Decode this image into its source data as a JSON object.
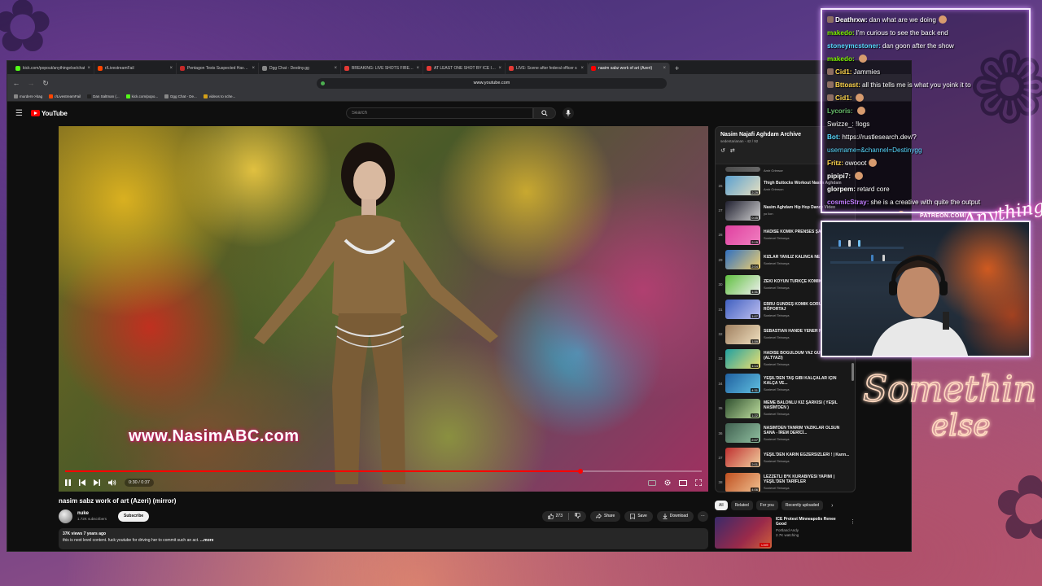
{
  "browser": {
    "tabs": [
      {
        "title": "kick.com/popout/anythingelse/chat",
        "color": "#53fc18"
      },
      {
        "title": "r/LivestreamFail",
        "color": "#ff4500"
      },
      {
        "title": "Pentagon Tests Suspected Havana",
        "color": "#c62828"
      },
      {
        "title": "Dgg Chat - Destiny.gg",
        "color": "#888888"
      },
      {
        "title": "BREAKING: LIVE SHOTS FIRED AN",
        "color": "#e53935"
      },
      {
        "title": "AT LEAST ONE SHOT BY ICE IN M",
        "color": "#e53935"
      },
      {
        "title": "LIVE: Scene after federal officer s",
        "color": "#e53935"
      },
      {
        "title": "nasim sabz work of art (Azeri)",
        "color": "#ff0000",
        "active": true
      }
    ],
    "url": "www.youtube.com",
    "bookmarks": [
      {
        "label": "murders->bag",
        "color": "#888888"
      },
      {
        "label": "r/LivestreamFail",
        "color": "#ff4500"
      },
      {
        "label": "Dan Saltman (...",
        "color": "#222222"
      },
      {
        "label": "kick.com/popo...",
        "color": "#53fc18"
      },
      {
        "label": "Dgg Chat - De...",
        "color": "#888888"
      },
      {
        "label": "videos to sche...",
        "color": "#d4a017"
      }
    ]
  },
  "youtube": {
    "logo_text": "YouTube",
    "search_placeholder": "Search",
    "video": {
      "watermark": "www.NasimABC.com",
      "time": "0:30 / 0:37",
      "progress": 0.81,
      "title": "nasim sabz work of art (Azeri) (mirror)",
      "channel": "nuke",
      "subscribers": "1.72K subscribers",
      "subscribe_label": "Subscribe",
      "likes": "273",
      "share_label": "Share",
      "save_label": "Save",
      "download_label": "Download",
      "views_age": "37K views  7 years ago",
      "description": "this is next level content. fuck youtube for driving her to commit such an act. ",
      "more_label": "...more"
    },
    "playlist": {
      "title": "Nasim Najafi Aghdam Archive",
      "subtitle": "sedentarianan - 42 / 92",
      "items": [
        {
          "num": "",
          "title": "",
          "channel": "Amir Grimson",
          "duration": "",
          "colors": [
            "#4a4a4a",
            "#6a6a6a"
          ]
        },
        {
          "num": "26",
          "title": "Thigh Buttocks Workout Nasim Aghdam",
          "channel": "Amir Grimson",
          "duration": "2:29",
          "colors": [
            "#5aa0d0",
            "#e8e0c0"
          ]
        },
        {
          "num": "27",
          "title": "Nasim Aghdam Hip Hop Dance Video",
          "channel": "yo lion",
          "duration": "0:45",
          "colors": [
            "#202030",
            "#d0d0d0"
          ]
        },
        {
          "num": "28",
          "title": "HADİSE KOMİK PRENSES ŞARKISI PARODİ",
          "channel": "Sonievel Teirunya",
          "duration": "2:15",
          "colors": [
            "#e040a0",
            "#f080c0"
          ]
        },
        {
          "num": "29",
          "title": "KIZLAR YANLIZ KALINCA NE YAPIYOR ?",
          "channel": "Sonievel Teirunya",
          "duration": "2:04",
          "colors": [
            "#3070c0",
            "#f0d070"
          ]
        },
        {
          "num": "30",
          "title": "ZEKİ KOYUN TÜRKÇE KOMİK ÇİZGİ FİLM",
          "channel": "Sonievel Teirunya",
          "duration": "1:31",
          "colors": [
            "#60c040",
            "#f0f0f0"
          ]
        },
        {
          "num": "31",
          "title": "EBRU GÜNDEŞ KOMİK GÖRÜŞME RÖPORTAJ",
          "channel": "Sonievel Teirunya",
          "duration": "1:07",
          "colors": [
            "#4060c0",
            "#c0c0f0"
          ]
        },
        {
          "num": "32",
          "title": "SEBASTIAN HANDE YENER PARODİ 2015",
          "channel": "Sonievel Teirunya",
          "duration": "1:59",
          "colors": [
            "#a08060",
            "#f0e0c0"
          ]
        },
        {
          "num": "33",
          "title": "HADİSE BOĞULDUM YAZ GÜNÜ 2015 Parodi (ALTYAZI)",
          "channel": "Sonievel Teirunya",
          "duration": "1:14",
          "colors": [
            "#20a0a0",
            "#f0e070"
          ]
        },
        {
          "num": "34",
          "title": "YEŞİL'DEN TAŞ GİBİ KALÇALAR İÇİN KALÇA VE...",
          "channel": "Sonievel Teirunya",
          "duration": "4:31",
          "colors": [
            "#2060a0",
            "#60c0e0"
          ]
        },
        {
          "num": "35",
          "title": "MEME BALONLU KIZ ŞARKISI ( YEŞİL NASİM'DEN )",
          "channel": "Sonievel Teirunya",
          "duration": "1:22",
          "colors": [
            "#305030",
            "#c0e0a0"
          ]
        },
        {
          "num": "36",
          "title": "NASİM'DEN TANRIM YAZIKLAR OLSUN SANA - İREM DERİCİ...",
          "channel": "Sonievel Teirunya",
          "duration": "2:07",
          "colors": [
            "#406050",
            "#90c0a0"
          ]
        },
        {
          "num": "37",
          "title": "YEŞİL'DEN KARIN EGZERSİZLERİ ! | Karın...",
          "channel": "Sonievel Teirunya",
          "duration": "2:01",
          "colors": [
            "#c03030",
            "#f0d0a0"
          ]
        },
        {
          "num": "38",
          "title": "LEZZETLİ B*K KURABİYESİ YAPIMI | YEŞİL'DEN TARİFLER",
          "channel": "Sonievel Teirunya",
          "duration": "4:06",
          "colors": [
            "#c05020",
            "#f0c090"
          ]
        }
      ]
    },
    "chips": [
      "All",
      "Related",
      "For you",
      "Recently uploaded"
    ],
    "recommendation": {
      "title": "ICE Protest Minneapolis Renee Good",
      "channel": "Portland Andy",
      "watching": "2.7K watching",
      "live_label": "LIVE"
    }
  },
  "chat": {
    "messages": [
      {
        "user": "Deathrxw:",
        "text": "dan what are we doing",
        "color": "#ffffff",
        "badge": true,
        "emote": true
      },
      {
        "user": "makedo:",
        "text": "I'm curious to see the back end",
        "color": "#7cf000",
        "badge": false,
        "emote": false
      },
      {
        "user": "stoneymcstoner:",
        "text": "dan goon after the show",
        "color": "#57d9ff",
        "badge": false,
        "emote": false
      },
      {
        "user": "makedo:",
        "text": "",
        "color": "#7cf000",
        "badge": false,
        "emote": true
      },
      {
        "user": "Cid1:",
        "text": "Jammies",
        "color": "#ffd54a",
        "badge": true,
        "emote": false
      },
      {
        "user": "Bttoast:",
        "text": "all this tells me is what you yoink it to",
        "color": "#ffd54a",
        "badge": true,
        "emote": false
      },
      {
        "user": "Cid1:",
        "text": "",
        "color": "#ffd54a",
        "badge": true,
        "emote": true
      },
      {
        "user": "Lycoris:",
        "text": "",
        "color": "#66bb6a",
        "badge": false,
        "emote": true
      },
      {
        "user": "",
        "text": "Swizze_: !logs",
        "color": "#ffffff",
        "badge": false,
        "emote": false
      },
      {
        "user": "Bot:",
        "text": "https://rustlesearch.dev/?",
        "color": "#57d9ff",
        "badge": false,
        "emote": false
      },
      {
        "user": "",
        "text": "username=&channel=Destinygg",
        "color": "#57d9ff",
        "badge": false,
        "emote": false
      },
      {
        "user": "Fritz:",
        "text": "owooot",
        "color": "#ffd54a",
        "badge": false,
        "emote": true
      },
      {
        "user": "pipipi7:",
        "text": "",
        "color": "#ffffff",
        "badge": false,
        "emote": true
      },
      {
        "user": "glorpem:",
        "text": "retard core",
        "color": "#ffffff",
        "badge": false,
        "emote": false
      },
      {
        "user": "cosmicStray:",
        "text": "she is a creative with quite the output",
        "color": "#c17cff",
        "badge": false,
        "emote": false
      },
      {
        "user": "TheSilverFlameKing:",
        "text": "",
        "color": "#ffd54a",
        "badge": false,
        "emote": true
      }
    ]
  },
  "overlay": {
    "patreon": "PATREON.COM/",
    "neon_top": "Anything else",
    "neon_logo_line1": "Something",
    "neon_logo_line2": "else"
  }
}
